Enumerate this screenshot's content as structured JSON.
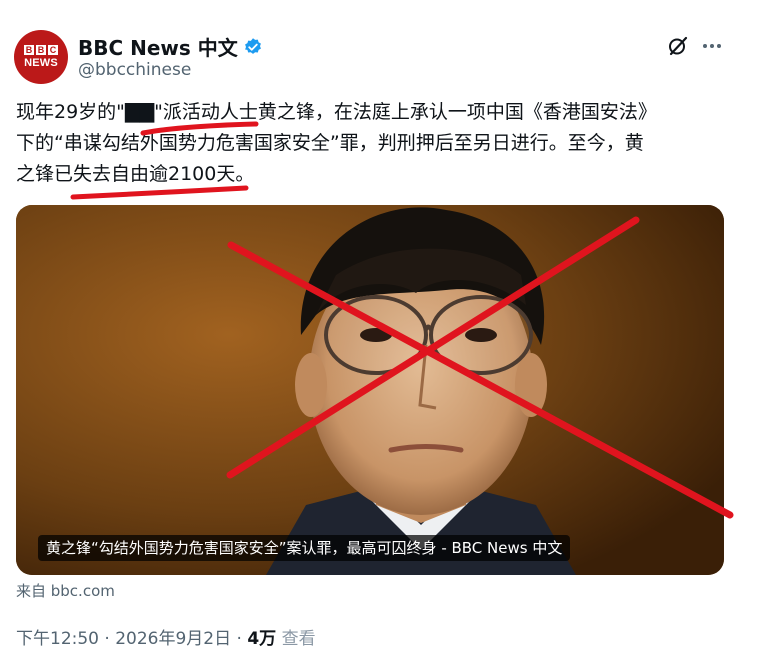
{
  "account": {
    "avatar_top": "BBC",
    "avatar_bottom": "NEWS",
    "name": "BBC News 中文",
    "handle": "@bbcchinese",
    "verified_color": "#1d9bf0",
    "brand_color": "#bb1919"
  },
  "header_icons": {
    "grok": "grok-icon",
    "more": "more-icon"
  },
  "tweet": {
    "line1": "现年29岁的\"▇▇\"派活动人士黄之锋，在法庭上承认一项中国《香港国安法》",
    "line2": "下的“串谋勾结外国势力危害国家安全”罪，判刑押后至另日进行。至今，黄",
    "line3": "之锋已失去自由逾2100天。"
  },
  "media": {
    "caption": "黄之锋“勾结外国势力危害国家安全”案认罪，最高可囚终身 - BBC News 中文",
    "source": "来自 bbc.com"
  },
  "meta": {
    "time": "下午12:50",
    "separator": "·",
    "date": "2026年9月2日",
    "views_count": "4万",
    "views_label": "查看"
  },
  "annotation_color": "#e0141e"
}
